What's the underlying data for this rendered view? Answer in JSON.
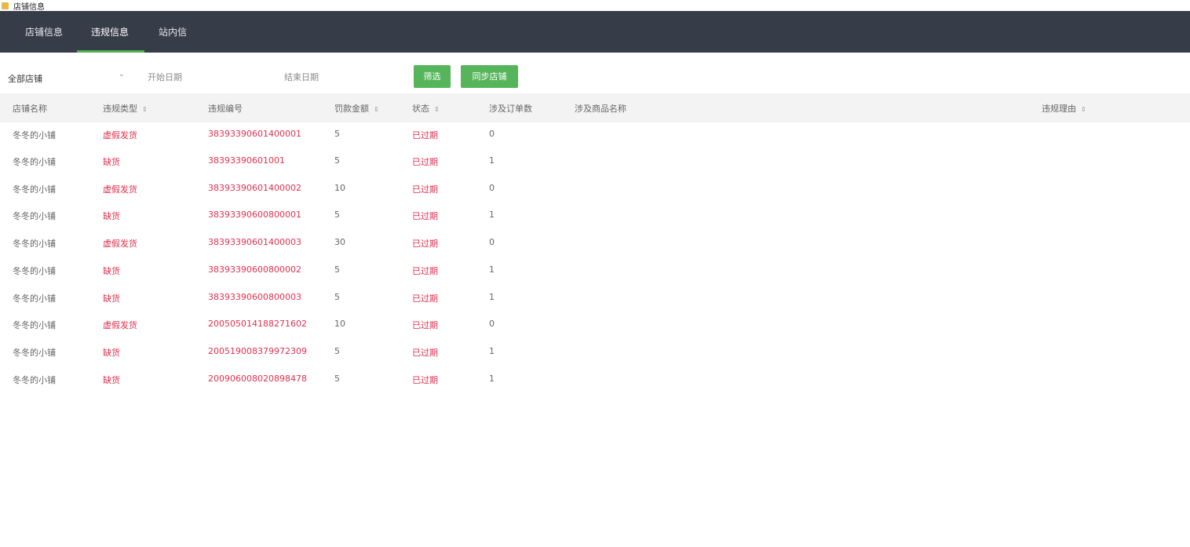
{
  "window": {
    "title": "店铺信息"
  },
  "tabs": [
    {
      "label": "店铺信息",
      "active": false
    },
    {
      "label": "违规信息",
      "active": true
    },
    {
      "label": "站内信",
      "active": false
    }
  ],
  "filters": {
    "store_select": "全部店铺",
    "start_date_placeholder": "开始日期",
    "end_date_placeholder": "结束日期",
    "filter_button": "筛选",
    "sync_button": "同步店铺"
  },
  "table": {
    "columns": [
      {
        "label": "店铺名称",
        "sortable": false
      },
      {
        "label": "违规类型",
        "sortable": true
      },
      {
        "label": "违规编号",
        "sortable": false
      },
      {
        "label": "罚款金额",
        "sortable": true
      },
      {
        "label": "状态",
        "sortable": true
      },
      {
        "label": "涉及订单数",
        "sortable": false
      },
      {
        "label": "涉及商品名称",
        "sortable": false
      },
      {
        "label": "违规理由",
        "sortable": true
      }
    ],
    "rows": [
      {
        "store": "冬冬的小铺",
        "type": "虚假发货",
        "number": "38393390601400001",
        "fine": "5",
        "status": "已过期",
        "orders": "0"
      },
      {
        "store": "冬冬的小铺",
        "type": "缺货",
        "number": "38393390601001",
        "fine": "5",
        "status": "已过期",
        "orders": "1"
      },
      {
        "store": "冬冬的小铺",
        "type": "虚假发货",
        "number": "38393390601400002",
        "fine": "10",
        "status": "已过期",
        "orders": "0"
      },
      {
        "store": "冬冬的小铺",
        "type": "缺货",
        "number": "38393390600800001",
        "fine": "5",
        "status": "已过期",
        "orders": "1"
      },
      {
        "store": "冬冬的小铺",
        "type": "虚假发货",
        "number": "38393390601400003",
        "fine": "30",
        "status": "已过期",
        "orders": "0"
      },
      {
        "store": "冬冬的小铺",
        "type": "缺货",
        "number": "38393390600800002",
        "fine": "5",
        "status": "已过期",
        "orders": "1"
      },
      {
        "store": "冬冬的小铺",
        "type": "缺货",
        "number": "38393390600800003",
        "fine": "5",
        "status": "已过期",
        "orders": "1"
      },
      {
        "store": "冬冬的小铺",
        "type": "虚假发货",
        "number": "200505014188271602",
        "fine": "10",
        "status": "已过期",
        "orders": "0"
      },
      {
        "store": "冬冬的小铺",
        "type": "缺货",
        "number": "200519008379972309",
        "fine": "5",
        "status": "已过期",
        "orders": "1"
      },
      {
        "store": "冬冬的小铺",
        "type": "缺货",
        "number": "200906008020898478",
        "fine": "5",
        "status": "已过期",
        "orders": "1"
      }
    ]
  },
  "colors": {
    "navbar": "#373d48",
    "accent": "#56b55a",
    "danger": "#e2304f"
  },
  "icons": {
    "sort": "sort-icon",
    "dropdown": "chevron-down-icon"
  }
}
